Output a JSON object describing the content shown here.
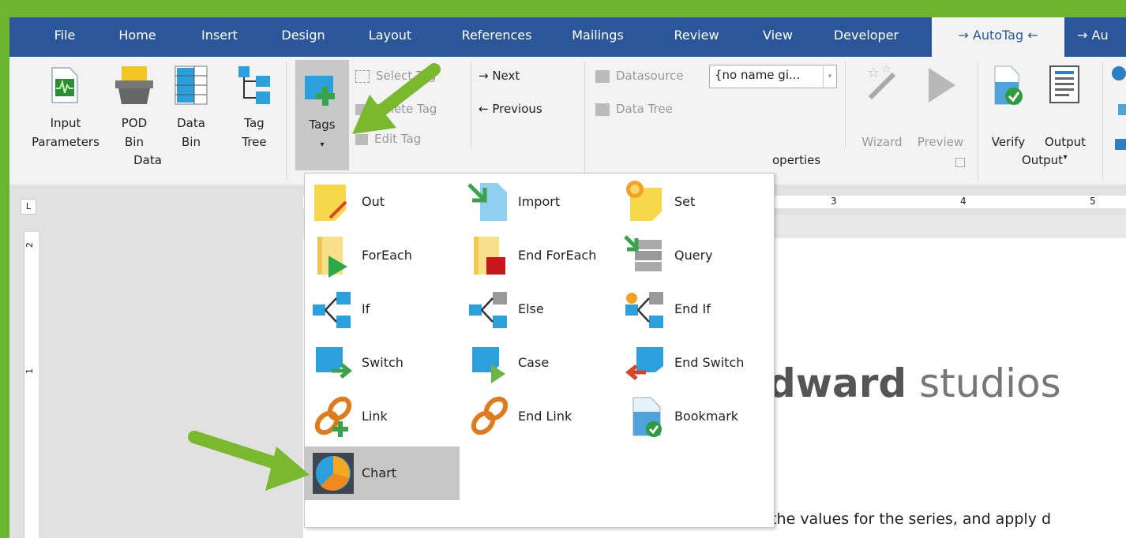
{
  "tabs": [
    "File",
    "Home",
    "Insert",
    "Design",
    "Layout",
    "References",
    "Mailings",
    "Review",
    "View",
    "Developer",
    "→ AutoTag ←",
    "→ Au"
  ],
  "active_tab_index": 10,
  "ribbon": {
    "data_group": {
      "label": "Data",
      "input_parameters": [
        "Input",
        "Parameters"
      ],
      "pod_bin": [
        "POD",
        "Bin"
      ],
      "data_bin": [
        "Data",
        "Bin"
      ],
      "tag_tree": [
        "Tag",
        "Tree"
      ]
    },
    "tags_button": "Tags",
    "select_tag": "Select Tag",
    "delete_tag": "Delete Tag",
    "edit_tag": "Edit Tag",
    "next": "→ Next",
    "previous": "← Previous",
    "datasource": "Datasource",
    "datasource_value": "{no name gi...",
    "data_tree": "Data Tree",
    "properties_label": "operties",
    "wizard": "Wizard",
    "preview": "Preview",
    "verify": "Verify",
    "output": "Output",
    "output_group_label": "Output"
  },
  "menu_items": [
    {
      "label": "Out",
      "icon": "out-icon"
    },
    {
      "label": "Import",
      "icon": "import-icon"
    },
    {
      "label": "Set",
      "icon": "set-icon"
    },
    {
      "label": "ForEach",
      "icon": "foreach-icon"
    },
    {
      "label": "End ForEach",
      "icon": "end-foreach-icon"
    },
    {
      "label": "Query",
      "icon": "query-icon"
    },
    {
      "label": "If",
      "icon": "if-icon"
    },
    {
      "label": "Else",
      "icon": "else-icon"
    },
    {
      "label": "End If",
      "icon": "end-if-icon"
    },
    {
      "label": "Switch",
      "icon": "switch-icon"
    },
    {
      "label": "Case",
      "icon": "case-icon"
    },
    {
      "label": "End Switch",
      "icon": "end-switch-icon"
    },
    {
      "label": "Link",
      "icon": "link-icon"
    },
    {
      "label": "End Link",
      "icon": "end-link-icon"
    },
    {
      "label": "Bookmark",
      "icon": "bookmark-icon"
    },
    {
      "label": "Chart",
      "icon": "chart-icon"
    }
  ],
  "ruler": {
    "marks": [
      "3",
      "4",
      "5"
    ],
    "corner": "L",
    "v_marks": [
      "2",
      "1"
    ]
  },
  "document": {
    "brand_bold": "dward",
    "brand_light": " studios",
    "body_text": "To create a chart insert the chart tag, define the values for the series, and apply d"
  },
  "colors": {
    "accent": "#2b579a",
    "frame": "#6cb52e",
    "arrow": "#7ab82e",
    "highlight": "#c6c6c6"
  }
}
